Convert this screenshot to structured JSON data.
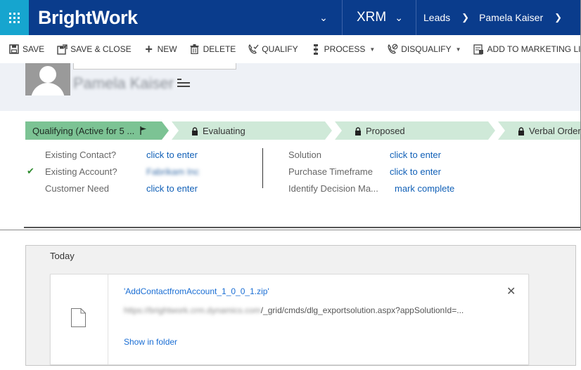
{
  "header": {
    "brand": "BrightWork",
    "app": "XRM",
    "breadcrumb": [
      "Leads",
      "Pamela Kaiser"
    ]
  },
  "commands": [
    {
      "label": "SAVE",
      "icon": "save-icon"
    },
    {
      "label": "SAVE & CLOSE",
      "icon": "save-close-icon"
    },
    {
      "label": "NEW",
      "icon": "plus-icon"
    },
    {
      "label": "DELETE",
      "icon": "trash-icon"
    },
    {
      "label": "QUALIFY",
      "icon": "phone-check-icon"
    },
    {
      "label": "PROCESS",
      "icon": "process-icon"
    },
    {
      "label": "DISQUALIFY",
      "icon": "disqualify-icon"
    },
    {
      "label": "ADD TO MARKETING LIST",
      "icon": "marketing-list-icon"
    }
  ],
  "record": {
    "name": "Pamela Kaiser"
  },
  "stages": [
    {
      "label": "Qualifying (Active for 5 ...",
      "active": true
    },
    {
      "label": "Evaluating",
      "active": false
    },
    {
      "label": "Proposed",
      "active": false
    },
    {
      "label": "Verbal Order",
      "active": false
    }
  ],
  "fields_left": [
    {
      "label": "Existing Contact?",
      "value": "click to enter",
      "checked": false
    },
    {
      "label": "Existing Account?",
      "value": "Fabrikam Inc",
      "checked": true
    },
    {
      "label": "Customer Need",
      "value": "click to enter",
      "checked": false
    }
  ],
  "fields_right": [
    {
      "label": "Solution",
      "value": "click to enter"
    },
    {
      "label": "Purchase Timeframe",
      "value": "click to enter"
    },
    {
      "label": "Identify Decision Ma...",
      "value": "mark complete"
    }
  ],
  "downloads": {
    "section": "Today",
    "filename": "'AddContactfromAccount_1_0_0_1.zip'",
    "url_prefix": "https://brightwork.crm.dynamics.com",
    "url_suffix": "/_grid/cmds/dlg_exportsolution.aspx?appSolutionId=...",
    "show_in_folder": "Show in folder"
  },
  "colors": {
    "topbar": "#0a3c8c",
    "waffle": "#16a5cf",
    "stage_active": "#7cc394",
    "stage_inactive": "#cfe9d8",
    "link": "#1160b7"
  }
}
